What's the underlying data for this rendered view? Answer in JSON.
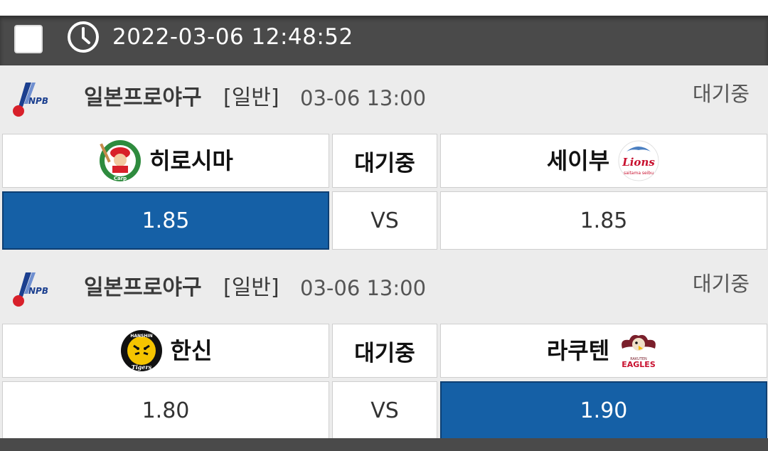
{
  "header": {
    "datetime": "2022-03-06 12:48:52"
  },
  "games": [
    {
      "league": "일본프로야구",
      "game_type": "[일반]",
      "time": "03-06 13:00",
      "status": "대기중",
      "home": {
        "name": "히로시마",
        "odds": "1.85",
        "logo": "carp-logo"
      },
      "mid_status": "대기중",
      "vs": "VS",
      "away": {
        "name": "세이부",
        "odds": "1.85",
        "logo": "lions-logo"
      }
    },
    {
      "league": "일본프로야구",
      "game_type": "[일반]",
      "time": "03-06 13:00",
      "status": "대기중",
      "home": {
        "name": "한신",
        "odds": "1.80",
        "logo": "tigers-logo"
      },
      "mid_status": "대기중",
      "vs": "VS",
      "away": {
        "name": "라쿠텐",
        "odds": "1.90",
        "logo": "eagles-logo"
      }
    }
  ],
  "colors": {
    "selected": "#1560a6",
    "header": "#4a4a4a",
    "section": "#ececec"
  }
}
